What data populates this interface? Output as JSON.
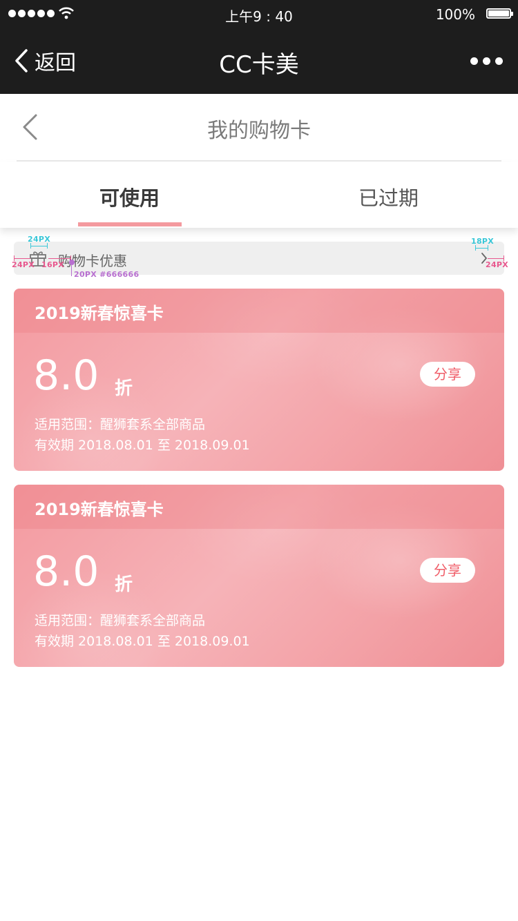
{
  "status_bar": {
    "time": "上午9 : 40",
    "battery": "100%"
  },
  "nav_bar": {
    "back_label": "返回",
    "title": "CC卡美"
  },
  "page": {
    "title": "我的购物卡"
  },
  "tabs": [
    {
      "label": "可使用"
    },
    {
      "label": "已过期"
    }
  ],
  "promo": {
    "label": "购物卡优惠",
    "annotations": {
      "gift_size": "24PX",
      "left_margin": "24PX",
      "icon_gap": "16PX",
      "text_style": "20PX #666666",
      "arrow_size": "18PX",
      "right_margin": "24PX"
    }
  },
  "cards": [
    {
      "title": "2019新春惊喜卡",
      "value": "8.0",
      "unit": "折",
      "share_label": "分享",
      "scope": "适用范围：醒狮套系全部商品",
      "period": "有效期 2018.08.01 至 2018.09.01"
    },
    {
      "title": "2019新春惊喜卡",
      "value": "8.0",
      "unit": "折",
      "share_label": "分享",
      "scope": "适用范围：醒狮套系全部商品",
      "period": "有效期 2018.08.01 至 2018.09.01"
    }
  ],
  "colors": {
    "bar_bg": "#1d1d1d",
    "accent_pink": "#f49a9f",
    "share_text": "#f05d68",
    "promo_text": "#666666"
  }
}
